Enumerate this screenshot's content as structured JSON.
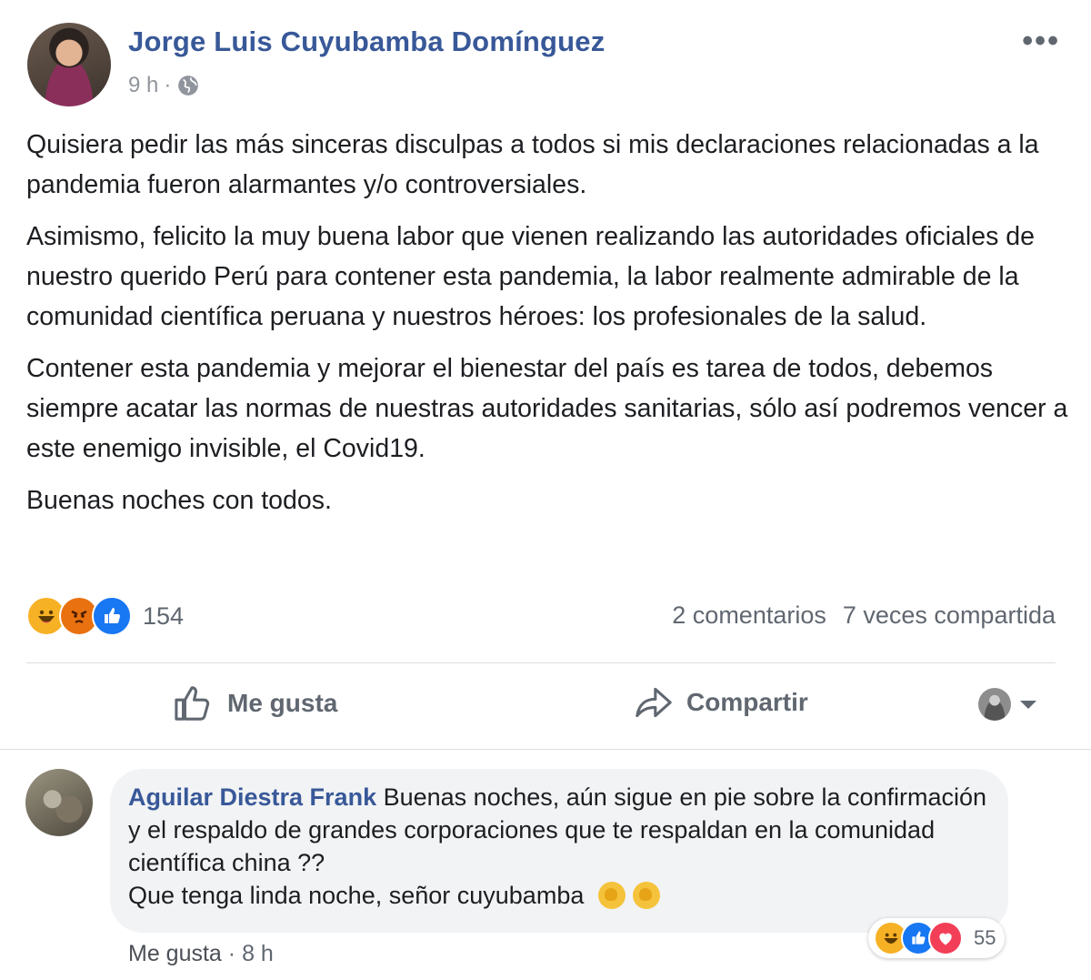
{
  "post": {
    "author": "Jorge Luis Cuyubamba Domínguez",
    "time": "9 h",
    "separator": "·",
    "audience_icon": "globe-icon",
    "more_icon": "more-options-icon",
    "paragraphs": [
      "Quisiera pedir las más sinceras disculpas a todos si mis declaraciones relacionadas a la pandemia fueron alarmantes y/o controversiales.",
      "Asimismo, felicito la muy buena labor que vienen realizando las autoridades oficiales de nuestro querido Perú para contener esta pandemia, la labor realmente admirable de la comunidad científica peruana y nuestros héroes: los profesionales de la salud.",
      "Contener esta pandemia y mejorar el bienestar del país es tarea de todos, debemos siempre acatar las normas de nuestras autoridades sanitarias, sólo así podremos vencer a este enemigo invisible, el Covid19.",
      "Buenas noches con todos."
    ],
    "reactions": {
      "icons": [
        "haha-reaction-icon",
        "angry-reaction-icon",
        "like-reaction-icon"
      ],
      "count": "154"
    },
    "comments_count": "2 comentarios",
    "shares_count": "7 veces compartida",
    "actions": {
      "like": "Me gusta",
      "share": "Compartir"
    }
  },
  "comment": {
    "author": "Aguilar Diestra Frank",
    "text": "Buenas noches, aún sigue en pie sobre la confirmación y el respaldo de grandes corporaciones que te respaldan en la comunidad científica china ??",
    "text2": "Que tenga linda noche, señor cuyubamba",
    "emoji_icons": [
      "clapping-hands-icon",
      "clapping-hands-icon"
    ],
    "reactions": {
      "icons": [
        "haha-reaction-icon",
        "like-reaction-icon",
        "love-reaction-icon"
      ],
      "count": "55"
    },
    "like_label": "Me gusta",
    "separator": "·",
    "time": "8 h"
  },
  "colors": {
    "link_blue": "#385898",
    "secondary_text": "#606770",
    "like_blue": "#1877f2",
    "haha_yellow": "#f7b125",
    "angry_orange": "#e9710f",
    "love_red": "#f33e58",
    "comment_bubble": "#f2f3f5"
  }
}
